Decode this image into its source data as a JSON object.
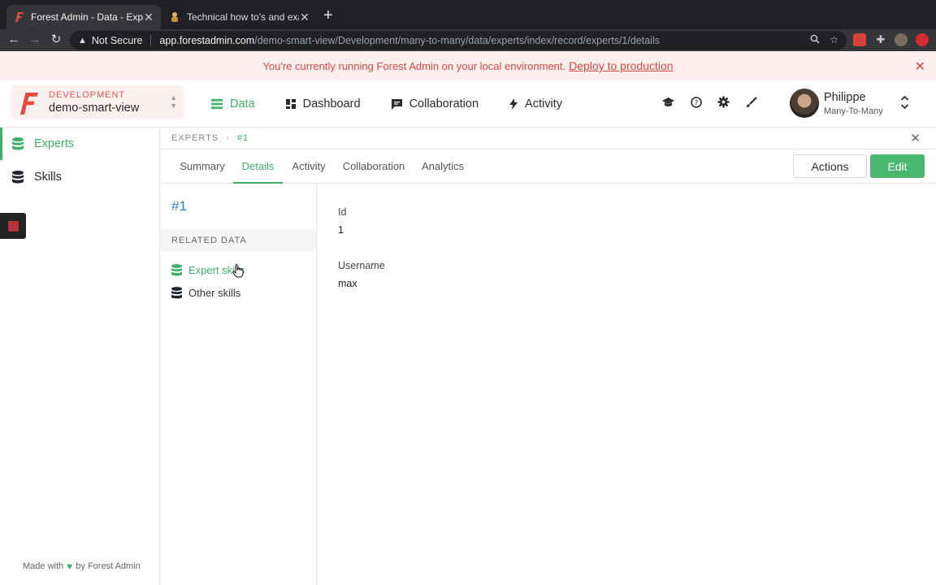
{
  "browser": {
    "tabs": [
      {
        "title": "Forest Admin - Data - Experts",
        "active": true
      },
      {
        "title": "Technical how to's and exampl",
        "active": false
      }
    ],
    "security_label": "Not Secure",
    "url_host": "app.forestadmin.com",
    "url_path": "/demo-smart-view/Development/many-to-many/data/experts/index/record/experts/1/details"
  },
  "banner": {
    "message": "You're currently running Forest Admin on your local environment.",
    "link": "Deploy to production"
  },
  "header": {
    "environment": {
      "label": "DEVELOPMENT",
      "name": "demo-smart-view"
    },
    "nav": [
      {
        "label": "Data",
        "active": true
      },
      {
        "label": "Dashboard",
        "active": false
      },
      {
        "label": "Collaboration",
        "active": false
      },
      {
        "label": "Activity",
        "active": false
      }
    ],
    "user": {
      "name": "Philippe",
      "role": "Many-To-Many"
    }
  },
  "sidebar": {
    "collections": [
      {
        "label": "Experts",
        "active": true
      },
      {
        "label": "Skills",
        "active": false
      }
    ],
    "footer": {
      "prefix": "Made with",
      "suffix": "by Forest Admin"
    }
  },
  "record": {
    "breadcrumb": {
      "collection": "EXPERTS",
      "current": "#1"
    },
    "tabs": [
      "Summary",
      "Details",
      "Activity",
      "Collaboration",
      "Analytics"
    ],
    "active_tab": "Details",
    "actions_label": "Actions",
    "edit_label": "Edit",
    "title": "#1",
    "related_title": "RELATED DATA",
    "related": [
      {
        "label": "Expert skills",
        "active": true
      },
      {
        "label": "Other skills",
        "active": false
      }
    ],
    "fields": [
      {
        "label": "Id",
        "value": "1"
      },
      {
        "label": "Username",
        "value": "max"
      }
    ]
  },
  "colors": {
    "accent": "#3fb16a",
    "warning": "#d44b3f",
    "link": "#2f7fc1"
  }
}
